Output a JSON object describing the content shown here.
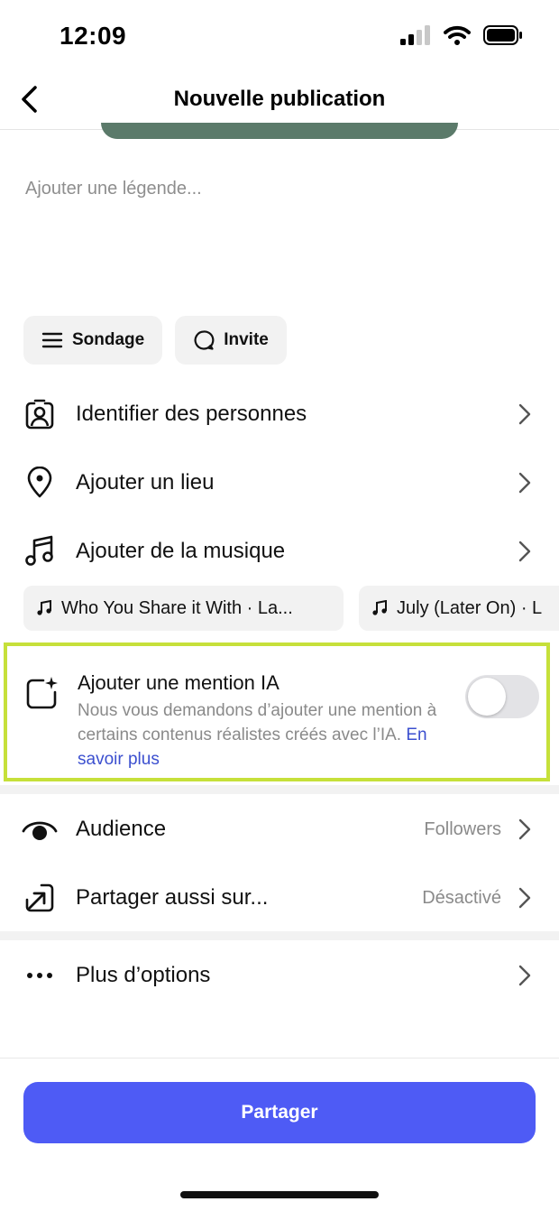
{
  "status_bar": {
    "time": "12:09",
    "icons": [
      "cellular-signal-icon",
      "wifi-icon",
      "battery-icon"
    ]
  },
  "nav": {
    "title": "Nouvelle publication",
    "back_icon": "chevron-left-icon"
  },
  "caption": {
    "placeholder": "Ajouter une légende..."
  },
  "chips": [
    {
      "label": "Sondage",
      "icon": "list-icon"
    },
    {
      "label": "Invite",
      "icon": "speech-bubble-icon"
    }
  ],
  "rows": {
    "tag_people": {
      "label": "Identifier des personnes",
      "icon": "person-tag-icon"
    },
    "add_location": {
      "label": "Ajouter un lieu",
      "icon": "location-pin-icon"
    },
    "add_music": {
      "label": "Ajouter de la musique",
      "icon": "music-note-icon"
    }
  },
  "music_suggestions": [
    {
      "title": "Who You Share it With · La..."
    },
    {
      "title": "July (Later On) · L"
    }
  ],
  "ai_label": {
    "title": "Ajouter une mention IA",
    "description": "Nous vous demandons d’ajouter une mention à certains contenus réalistes créés avec l’IA.",
    "link": "En savoir plus",
    "enabled": false,
    "highlight_color": "#c6e03a"
  },
  "audience": {
    "label": "Audience",
    "value": "Followers",
    "icon": "eye-icon"
  },
  "share_also": {
    "label": "Partager aussi sur...",
    "value": "Désactivé",
    "icon": "share-arrow-icon"
  },
  "more_options": {
    "label": "Plus d’options",
    "icon": "more-dots-icon"
  },
  "share_button": {
    "label": "Partager",
    "color": "#4e5bf5"
  }
}
